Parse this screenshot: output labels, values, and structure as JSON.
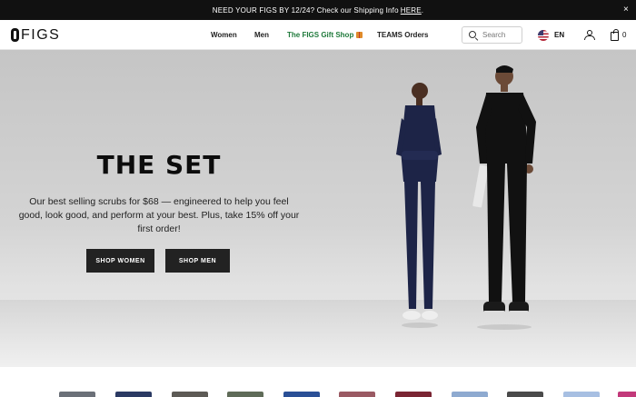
{
  "announcement": {
    "text": "NEED YOUR FIGS BY 12/24? Check our Shipping Info",
    "link": "HERE",
    "suffix": ".",
    "close": "×"
  },
  "nav": {
    "logo": "FIGS",
    "menu": [
      "Women",
      "Men",
      "The FIGS Gift Shop",
      "TEAMS Orders"
    ],
    "search_placeholder": "Search",
    "language": "EN",
    "cart_count": "0"
  },
  "hero": {
    "title": "THE SET",
    "copy": "Our best selling scrubs for $68 — engineered to help you feel good, look good, and perform at your best. Plus, take 15% off your first order!",
    "buttons": [
      "SHOP WOMEN",
      "SHOP MEN"
    ]
  },
  "colors": {
    "accent_green": "#1f7a3b",
    "dark": "#111111",
    "swatches": [
      "#6b7078",
      "#2b3a63",
      "#5d5a55",
      "#5f6b58",
      "#2a4f96",
      "#9a5a63",
      "#7a2533",
      "#8eaad0",
      "#4a4a4a",
      "#a7bfe2",
      "#c2397a"
    ]
  }
}
